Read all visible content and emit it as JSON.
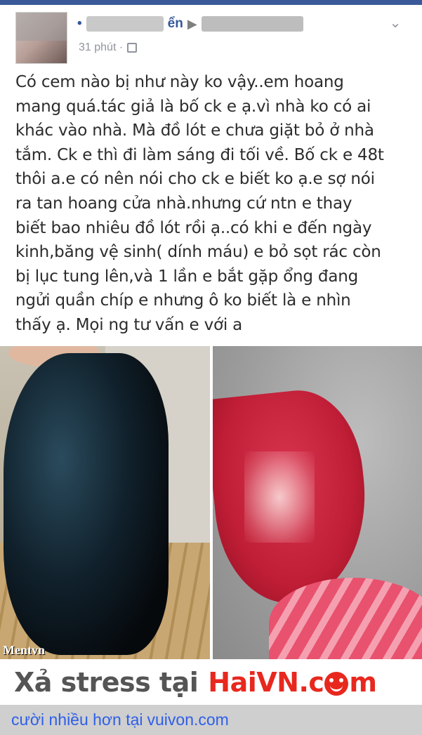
{
  "post": {
    "author_initial": "•",
    "author_suffix": "ển",
    "arrow": "▶",
    "time": "31 phút ·",
    "menu_icon": "chevron-down-icon",
    "text_lines": [
      "Có cem nào bị như này ko vậy..em hoang",
      "mang quá.tác giả là bố ck e ạ.vì nhà ko có ai",
      "khác vào nhà. Mà đồ lót e chưa giặt bỏ ở nhà",
      "tắm. Ck e thì đi làm sáng đi tối về. Bố ck e 48t",
      "thôi a.e có nên nói cho ck e biết ko ạ.e sợ nói",
      "ra tan hoang cửa nhà.nhưng cứ ntn e thay",
      "biết bao nhiêu đồ lót rồi ạ..có khi e đến ngày",
      "kinh,băng vệ sinh( dính máu) e bỏ sọt rác còn",
      "bị lục tung lên,và 1 lần e bắt gặp ổng đang",
      "ngửi quần chíp e nhưng ô ko biết là e nhìn",
      "thấy ạ. Mọi ng tư vấn e với a"
    ],
    "photo_watermark": "Mentvn"
  },
  "brand": {
    "prefix": "Xả stress tại",
    "site_part1": "HaiVN.c",
    "site_part2": "m"
  },
  "footer": {
    "text": "cười nhiều hơn tại",
    "link": "vuivon.com"
  },
  "colors": {
    "facebook_blue": "#3b5998",
    "brand_red": "#e8281e",
    "footer_link": "#2e5fe8"
  }
}
